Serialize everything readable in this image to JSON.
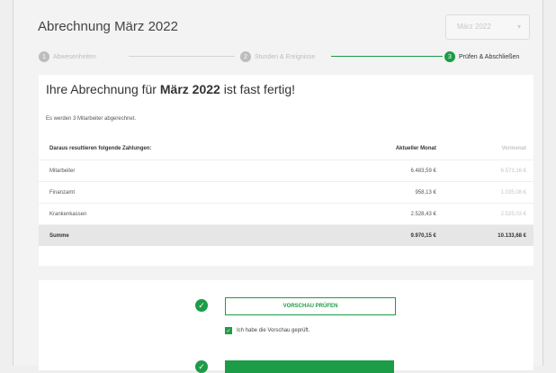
{
  "page": {
    "title": "Abrechnung März 2022"
  },
  "month_select": {
    "value": "März 2022"
  },
  "steps": [
    {
      "number": "1",
      "label": "Abwesenheiten",
      "active": false
    },
    {
      "number": "2",
      "label": "Stunden & Ereignisse",
      "active": false
    },
    {
      "number": "3",
      "label": "Prüfen & Abschließen",
      "active": true
    }
  ],
  "summary": {
    "headline_prefix": "Ihre Abrechnung für",
    "headline_month": "März 2022",
    "headline_suffix": "ist fast fertig!",
    "note": "Es werden 3 Mitarbeiter abgerechnet."
  },
  "table": {
    "headers": [
      "Daraus resultieren folgende Zahlungen:",
      "Aktueller Monat",
      "Vormonat"
    ],
    "rows": [
      {
        "label": "Mitarbeiter",
        "current": "6.483,59 €",
        "previous": "6.573,16 €"
      },
      {
        "label": "Finanzamt",
        "current": "958,13 €",
        "previous": "1.035,08 €"
      },
      {
        "label": "Krankenkassen",
        "current": "2.528,43 €",
        "previous": "2.525,03 €"
      }
    ],
    "total": {
      "label": "Summe",
      "current": "9.970,15 €",
      "previous": "10.133,68 €"
    }
  },
  "actions": {
    "preview_button": "VORSCHAU PRÜFEN",
    "confirm_checkbox": "Ich habe die Vorschau geprüft.",
    "check_mark": "✓"
  },
  "colors": {
    "accent": "#1c9c47"
  }
}
